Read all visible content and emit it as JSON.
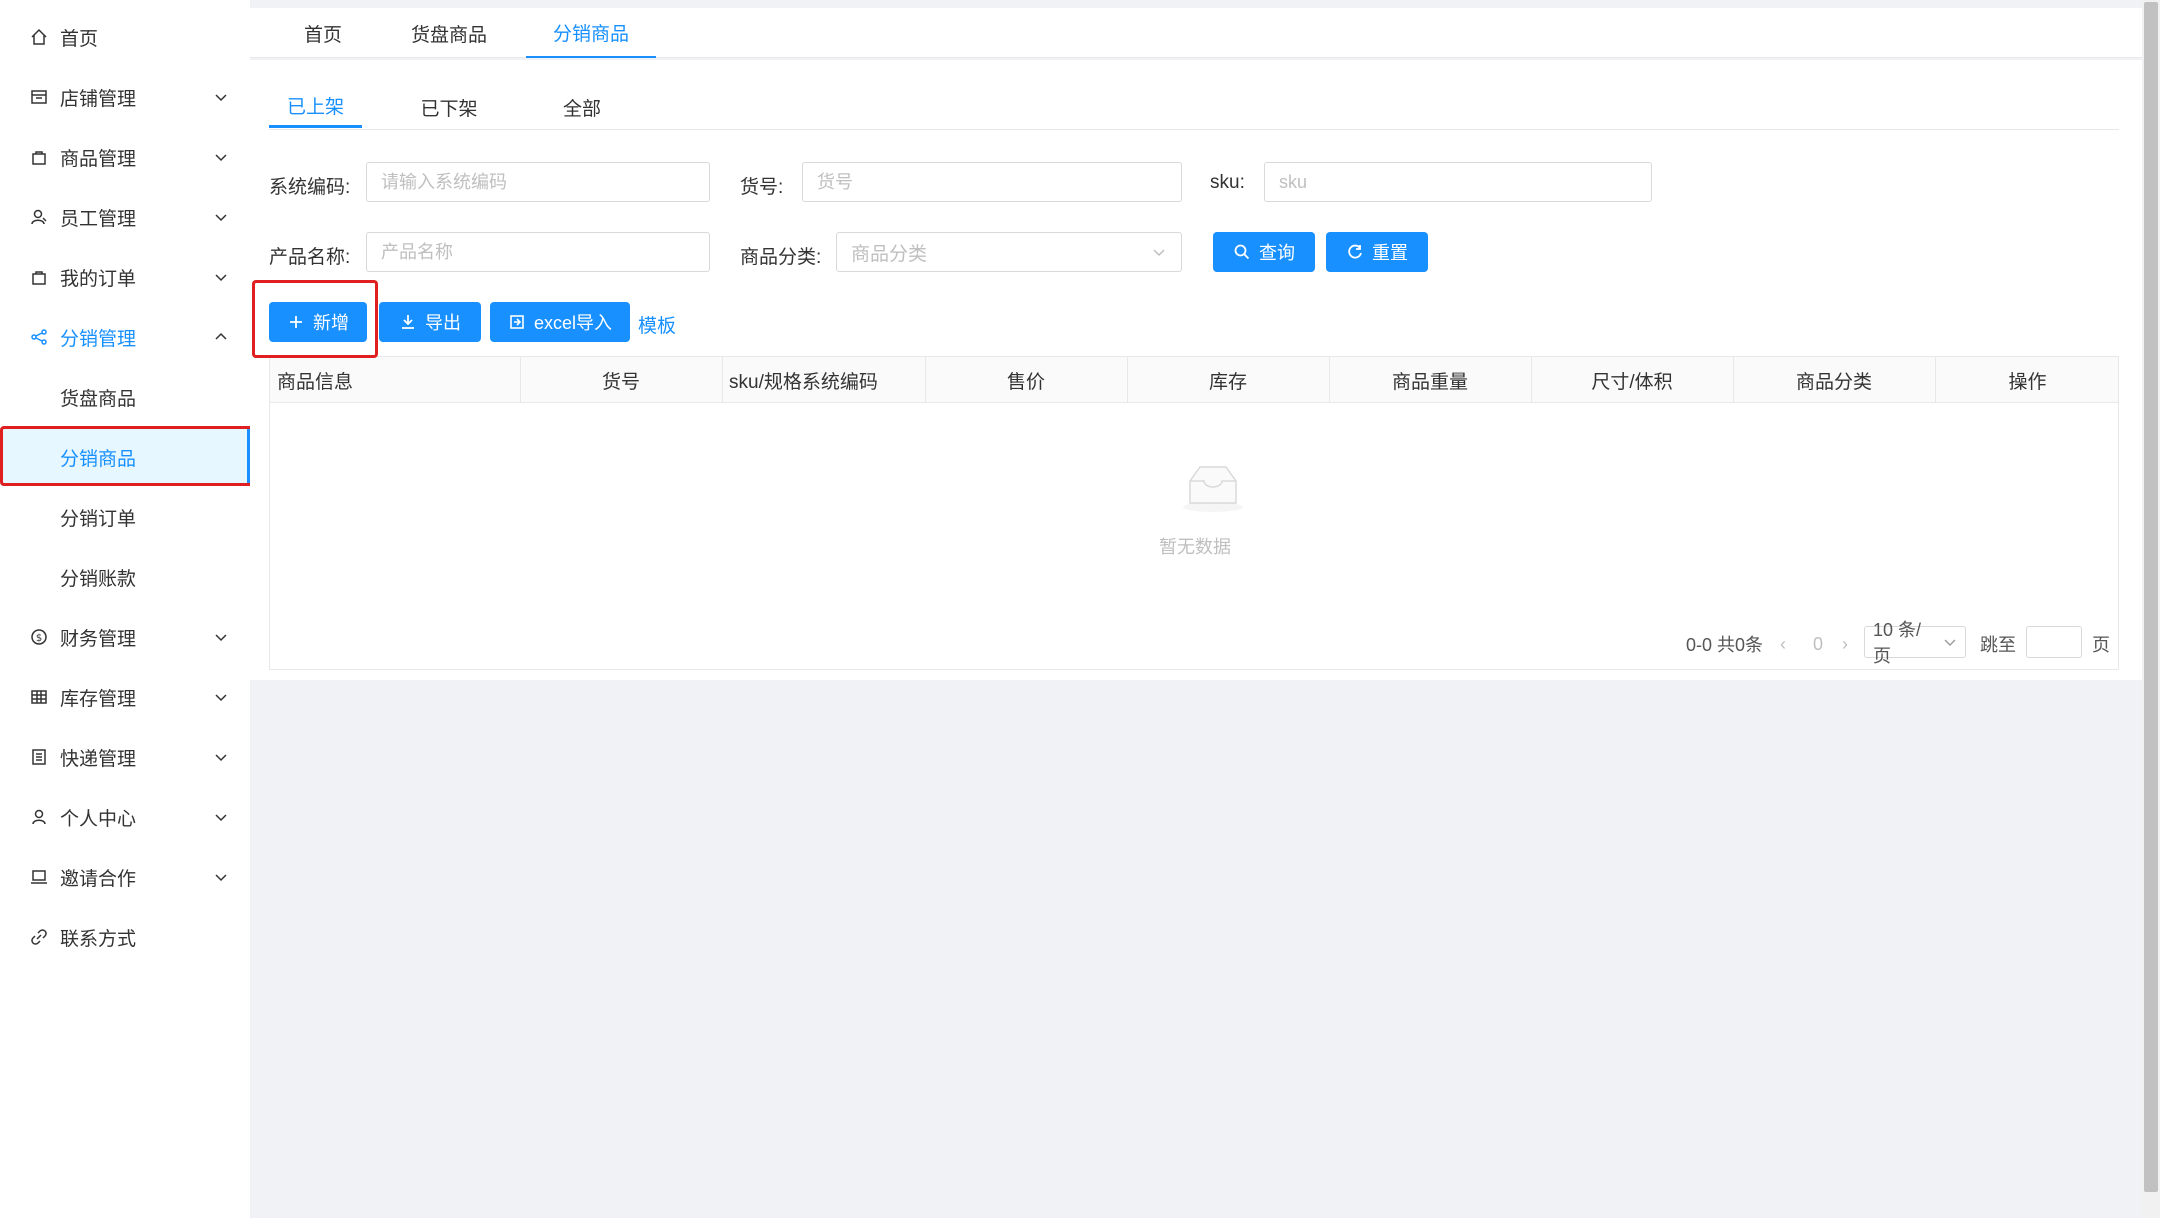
{
  "sidebar": {
    "items": [
      {
        "label": "首页",
        "icon": "home-icon",
        "expandable": false
      },
      {
        "label": "店铺管理",
        "icon": "shop-icon",
        "expandable": true
      },
      {
        "label": "商品管理",
        "icon": "bag-icon",
        "expandable": true
      },
      {
        "label": "员工管理",
        "icon": "staff-icon",
        "expandable": true
      },
      {
        "label": "我的订单",
        "icon": "bag-icon",
        "expandable": true
      },
      {
        "label": "分销管理",
        "icon": "share-icon",
        "expandable": true,
        "expanded": true
      },
      {
        "label": "货盘商品",
        "sub": true
      },
      {
        "label": "分销商品",
        "sub": true,
        "selected": true
      },
      {
        "label": "分销订单",
        "sub": true
      },
      {
        "label": "分销账款",
        "sub": true
      },
      {
        "label": "财务管理",
        "icon": "dollar-icon",
        "expandable": true
      },
      {
        "label": "库存管理",
        "icon": "table-icon",
        "expandable": true
      },
      {
        "label": "快递管理",
        "icon": "list-icon",
        "expandable": true
      },
      {
        "label": "个人中心",
        "icon": "user-icon",
        "expandable": true
      },
      {
        "label": "邀请合作",
        "icon": "laptop-icon",
        "expandable": true
      },
      {
        "label": "联系方式",
        "icon": "link-icon",
        "expandable": false
      }
    ]
  },
  "top_tabs": [
    "首页",
    "货盘商品",
    "分销商品"
  ],
  "sub_tabs": [
    "已上架",
    "已下架",
    "全部"
  ],
  "filters": {
    "system_code_label": "系统编码:",
    "system_code_placeholder": "请输入系统编码",
    "item_no_label": "货号:",
    "item_no_placeholder": "货号",
    "sku_label": "sku:",
    "sku_placeholder": "sku",
    "product_name_label": "产品名称:",
    "product_name_placeholder": "产品名称",
    "category_label": "商品分类:",
    "category_placeholder": "商品分类",
    "query_label": "查询",
    "reset_label": "重置"
  },
  "actions": {
    "add_label": "新增",
    "export_label": "导出",
    "excel_import_label": "excel导入",
    "template_link": "模板"
  },
  "table": {
    "columns": [
      "商品信息",
      "货号",
      "sku/规格系统编码",
      "售价",
      "库存",
      "商品重量",
      "尺寸/体积",
      "商品分类",
      "操作"
    ],
    "empty_text": "暂无数据"
  },
  "pagination": {
    "range_text": "0-0 共0条",
    "current_page": "0",
    "page_size": "10 条/页",
    "jump_label": "跳至",
    "page_suffix": "页"
  },
  "colors": {
    "accent": "#1890ff",
    "highlight": "#e02020"
  }
}
